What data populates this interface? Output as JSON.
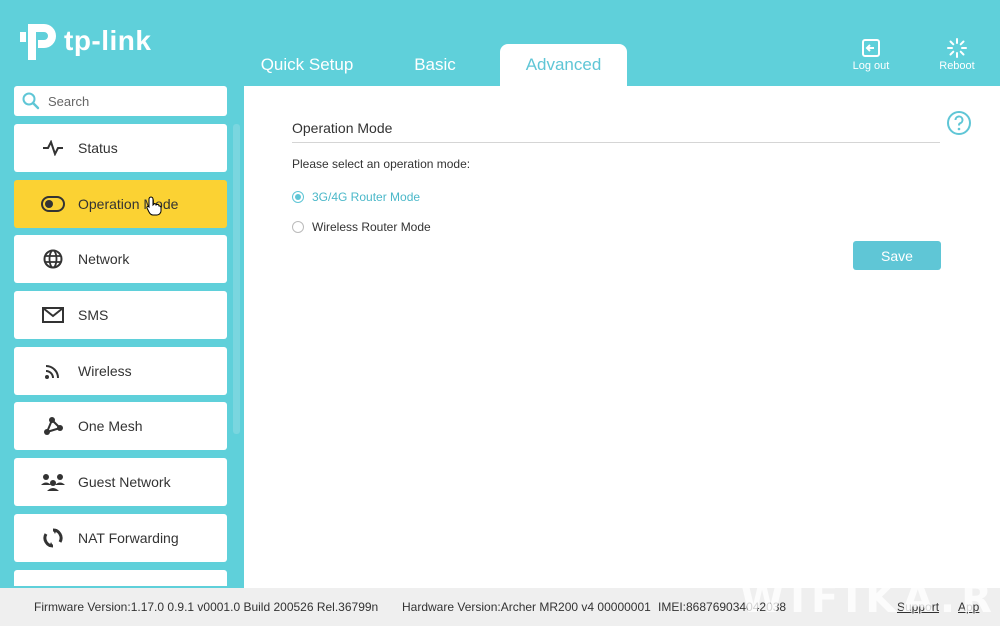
{
  "brand": {
    "name": "tp-link"
  },
  "tabs": [
    {
      "label": "Quick Setup",
      "active": false
    },
    {
      "label": "Basic",
      "active": false
    },
    {
      "label": "Advanced",
      "active": true
    }
  ],
  "header_actions": {
    "logout_label": "Log out",
    "reboot_label": "Reboot"
  },
  "search": {
    "placeholder": "Search",
    "value": ""
  },
  "sidebar": {
    "items": [
      {
        "label": "Status",
        "icon": "pulse-icon",
        "active": false
      },
      {
        "label": "Operation Mode",
        "icon": "toggle-icon",
        "active": true
      },
      {
        "label": "Network",
        "icon": "globe-icon",
        "active": false
      },
      {
        "label": "SMS",
        "icon": "envelope-icon",
        "active": false
      },
      {
        "label": "Wireless",
        "icon": "wifi-icon",
        "active": false
      },
      {
        "label": "One Mesh",
        "icon": "mesh-icon",
        "active": false
      },
      {
        "label": "Guest Network",
        "icon": "guests-icon",
        "active": false
      },
      {
        "label": "NAT Forwarding",
        "icon": "nat-icon",
        "active": false
      }
    ]
  },
  "main": {
    "title": "Operation Mode",
    "prompt": "Please select an operation mode:",
    "options": [
      {
        "label": "3G/4G Router Mode",
        "checked": true
      },
      {
        "label": "Wireless Router Mode",
        "checked": false
      }
    ],
    "save_label": "Save"
  },
  "footer": {
    "firmware": "Firmware Version:1.17.0 0.9.1 v0001.0 Build 200526 Rel.36799n",
    "hardware": "Hardware Version:Archer MR200 v4 00000001",
    "imei": "IMEI:868769034042038",
    "support_label": "Support",
    "app_label": "App"
  },
  "watermark": "WIFIKA.RU",
  "colors": {
    "accent": "#5fd0da",
    "active_item": "#fbd233",
    "button": "#5fc6d6"
  }
}
